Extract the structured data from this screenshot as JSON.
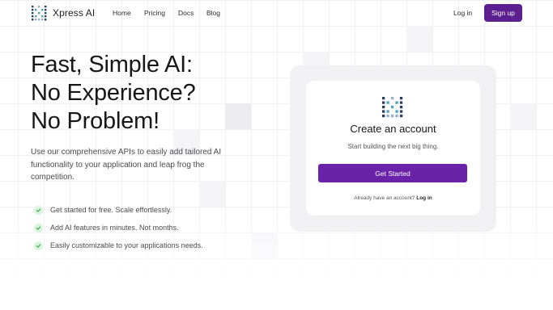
{
  "nav": {
    "brand": "Xpress AI",
    "links": [
      "Home",
      "Pricing",
      "Docs",
      "Blog"
    ],
    "login": "Log in",
    "signup": "Sign up"
  },
  "hero": {
    "title_lines": [
      "Fast, Simple AI:",
      "No Experience?",
      "No Problem!"
    ],
    "subtitle": "Use our comprehensive APIs to easily add tailored AI functionality to your application and leap frog the competition.",
    "features": [
      "Get started for free. Scale effortlessly.",
      "Add AI features in minutes. Not months.",
      "Easily customizable to your applications needs."
    ]
  },
  "card": {
    "title": "Create an account",
    "subtitle": "Start building the next big thing.",
    "button": "Get Started",
    "footer_text": "Already have an account?",
    "footer_link": "Log in"
  },
  "colors": {
    "brand_purple": "#5c1f8f",
    "button_purple": "#6a23a8",
    "check_green": "#3aa34a"
  },
  "icons": {
    "logo": "xpress-ai-logo-icon",
    "check": "check-icon"
  }
}
